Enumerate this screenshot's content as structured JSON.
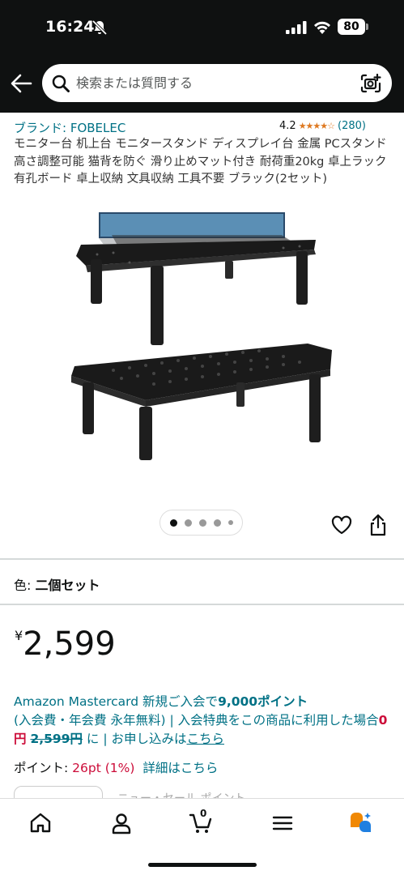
{
  "status_bar": {
    "time": "16:24",
    "battery": "80"
  },
  "search": {
    "placeholder": "検索または質問する"
  },
  "product": {
    "brand": "ブランド: FOBELEC",
    "rating_value": "4.2",
    "rating_stars": 4.2,
    "rating_count": "(280)",
    "title": "モニター台 机上台 モニタースタンド ディスプレイ台 金属 PCスタンド 高さ調整可能 猫背を防ぐ 滑り止めマット付き 耐荷重20kg 卓上ラック 有孔ボード 卓上収納 文具収納 工具不要 ブラック(2セット)",
    "image_count": 5,
    "image_active_index": 0
  },
  "variation": {
    "label": "色: ",
    "value": "二個セット"
  },
  "price": {
    "currency": "¥",
    "amount": "2,599"
  },
  "promo": {
    "line1a": "Amazon Mastercard 新規ご入会で",
    "line1b": "9,000ポイント",
    "line2": "(入会費・年会費 永年無料) | 入会特典をこの商品に利用した場合",
    "zero": "0円",
    "original": "2,599円",
    "suffix": " に | お申し込みは",
    "link": "こちら"
  },
  "points": {
    "label": "ポイント: ",
    "value": "26pt",
    "percent": "(1%)",
    "link": "詳細はこちら"
  },
  "peek_text": "ニュー・セール ポイント...",
  "bottom_nav": {
    "cart_count": "0"
  },
  "colors": {
    "header_bg": "#0f1111",
    "link": "#007185",
    "star": "#de7921",
    "price_red": "#cc0c39"
  }
}
